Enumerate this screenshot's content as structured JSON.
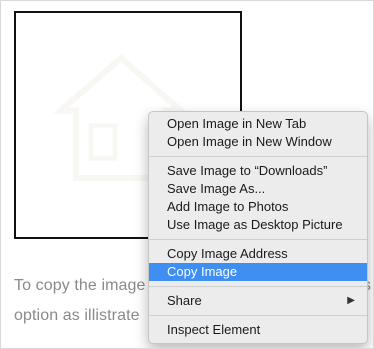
{
  "article": {
    "line1": "To copy the image",
    "line1_tail": "s",
    "line2": "option as illistrate"
  },
  "context_menu": {
    "groups": [
      [
        {
          "label": "Open Image in New Tab"
        },
        {
          "label": "Open Image in New Window"
        }
      ],
      [
        {
          "label": "Save Image to “Downloads”"
        },
        {
          "label": "Save Image As..."
        },
        {
          "label": "Add Image to Photos"
        },
        {
          "label": "Use Image as Desktop Picture"
        }
      ],
      [
        {
          "label": "Copy Image Address"
        },
        {
          "label": "Copy Image",
          "selected": true
        }
      ],
      [
        {
          "label": "Share",
          "submenu": true
        }
      ],
      [
        {
          "label": "Inspect Element"
        }
      ]
    ],
    "submenu_glyph": "▶"
  },
  "colors": {
    "selection": "#3f8ef2",
    "menu_bg": "#ececec",
    "body_text": "#8a8a8a"
  }
}
